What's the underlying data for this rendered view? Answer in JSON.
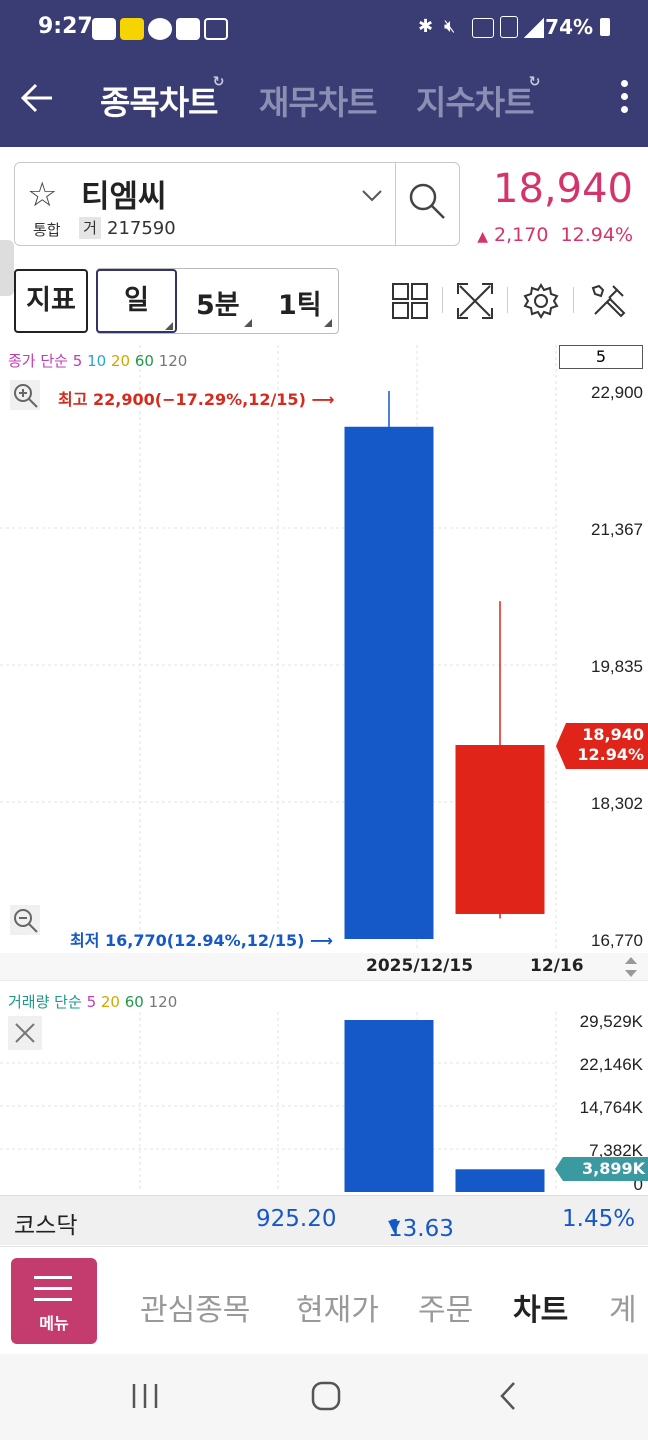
{
  "status_bar": {
    "time": "9:27",
    "battery": "74%",
    "icons": [
      "talk-icon",
      "kakao-icon",
      "coffee-icon",
      "k-icon",
      "voicemail-icon",
      "bluetooth-icon",
      "mute-icon",
      "hd-voice-icon",
      "5g-icon",
      "signal-icon",
      "battery-icon"
    ]
  },
  "header": {
    "tabs": [
      "종목차트",
      "재무차트",
      "지수차트"
    ],
    "active_tab": "종목차트"
  },
  "stock": {
    "name": "티엠씨",
    "market": "통합",
    "badge": "거",
    "code": "217590",
    "price": "18,940",
    "change": "2,170",
    "change_pct": "12.94%"
  },
  "toolbar": {
    "indicator": "지표",
    "period": "일",
    "minute": "5분",
    "tick": "1틱"
  },
  "chart": {
    "legend_label": "종가 단순",
    "ma_periods": [
      "5",
      "10",
      "20",
      "60",
      "120"
    ],
    "ma_colors": [
      "#c23cb5",
      "#23a6d5",
      "#d6a500",
      "#1f9a4c",
      "#777777"
    ],
    "count_box": "5",
    "y_ticks": [
      "22,900",
      "21,367",
      "19,835",
      "18,302",
      "16,770"
    ],
    "high_label": "최고 22,900(−17.29%,12/15) ⟶",
    "low_label": "최저 16,770(12.94%,12/15) ⟶",
    "current_price": "18,940",
    "current_pct": "12.94%",
    "x_labels": [
      "2025/12/15",
      "12/16"
    ],
    "up_color": "#e0241a",
    "down_color": "#1558c8"
  },
  "chart_data": [
    {
      "type": "candlestick",
      "x": [
        "2025/12/15",
        "12/16"
      ],
      "open": [
        22500,
        17050
      ],
      "high": [
        22900,
        20550
      ],
      "low": [
        16770,
        17000
      ],
      "close": [
        16770,
        18940
      ],
      "ylim": [
        16770,
        22900
      ]
    },
    {
      "type": "bar",
      "categories": [
        "2025/12/15",
        "12/16"
      ],
      "values": [
        29529,
        3899
      ],
      "ylim": [
        0,
        29529
      ]
    }
  ],
  "volume": {
    "legend_label": "거래량 단순",
    "ma_periods": [
      "5",
      "20",
      "60",
      "120"
    ],
    "ma_colors": [
      "#c23cb5",
      "#d6a500",
      "#1f9a4c",
      "#777777"
    ],
    "y_ticks": [
      "29,529K",
      "22,146K",
      "14,764K",
      "7,382K",
      "0"
    ],
    "current": "3,899K"
  },
  "kosdaq": {
    "name": "코스닥",
    "value": "925.20",
    "change": "13.63",
    "pct": "1.45%"
  },
  "bottom_nav": {
    "menu": "메뉴",
    "items": [
      "관심종목",
      "현재가",
      "주문",
      "차트",
      "계"
    ],
    "active": "차트"
  }
}
